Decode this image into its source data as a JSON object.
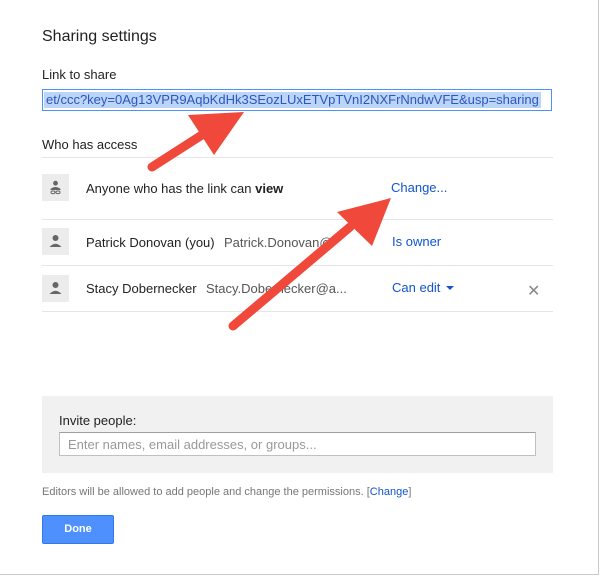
{
  "dialog": {
    "title": "Sharing settings",
    "link_section_label": "Link to share",
    "link_value": "et/ccc?key=0Ag13VPR9AqbKdHk3SEozLUxETVpTVnI2NXFrNndwVFE&usp=sharing",
    "access_section_label": "Who has access"
  },
  "access_rows": [
    {
      "icon": "link-person-icon",
      "name_prefix": "Anyone who has the link can ",
      "name_bold": "view",
      "permission": "Change..."
    },
    {
      "icon": "person-icon",
      "name": "Patrick Donovan (you)",
      "email": "Patrick.Donovan@",
      "permission": "Is owner"
    },
    {
      "icon": "person-icon",
      "name": "Stacy Dobernecker",
      "email": "Stacy.Dobernecker@a...",
      "permission": "Can edit",
      "remove": "✕"
    }
  ],
  "invite": {
    "label": "Invite people:",
    "placeholder": "Enter names, email addresses, or groups..."
  },
  "footer": {
    "note": "Editors will be allowed to add people and change the permissions.",
    "change_link": "Change"
  },
  "done_button": "Done",
  "colors": {
    "accent": "#4d90fe",
    "link": "#1155cc",
    "annotation_arrow": "#f0483a"
  }
}
